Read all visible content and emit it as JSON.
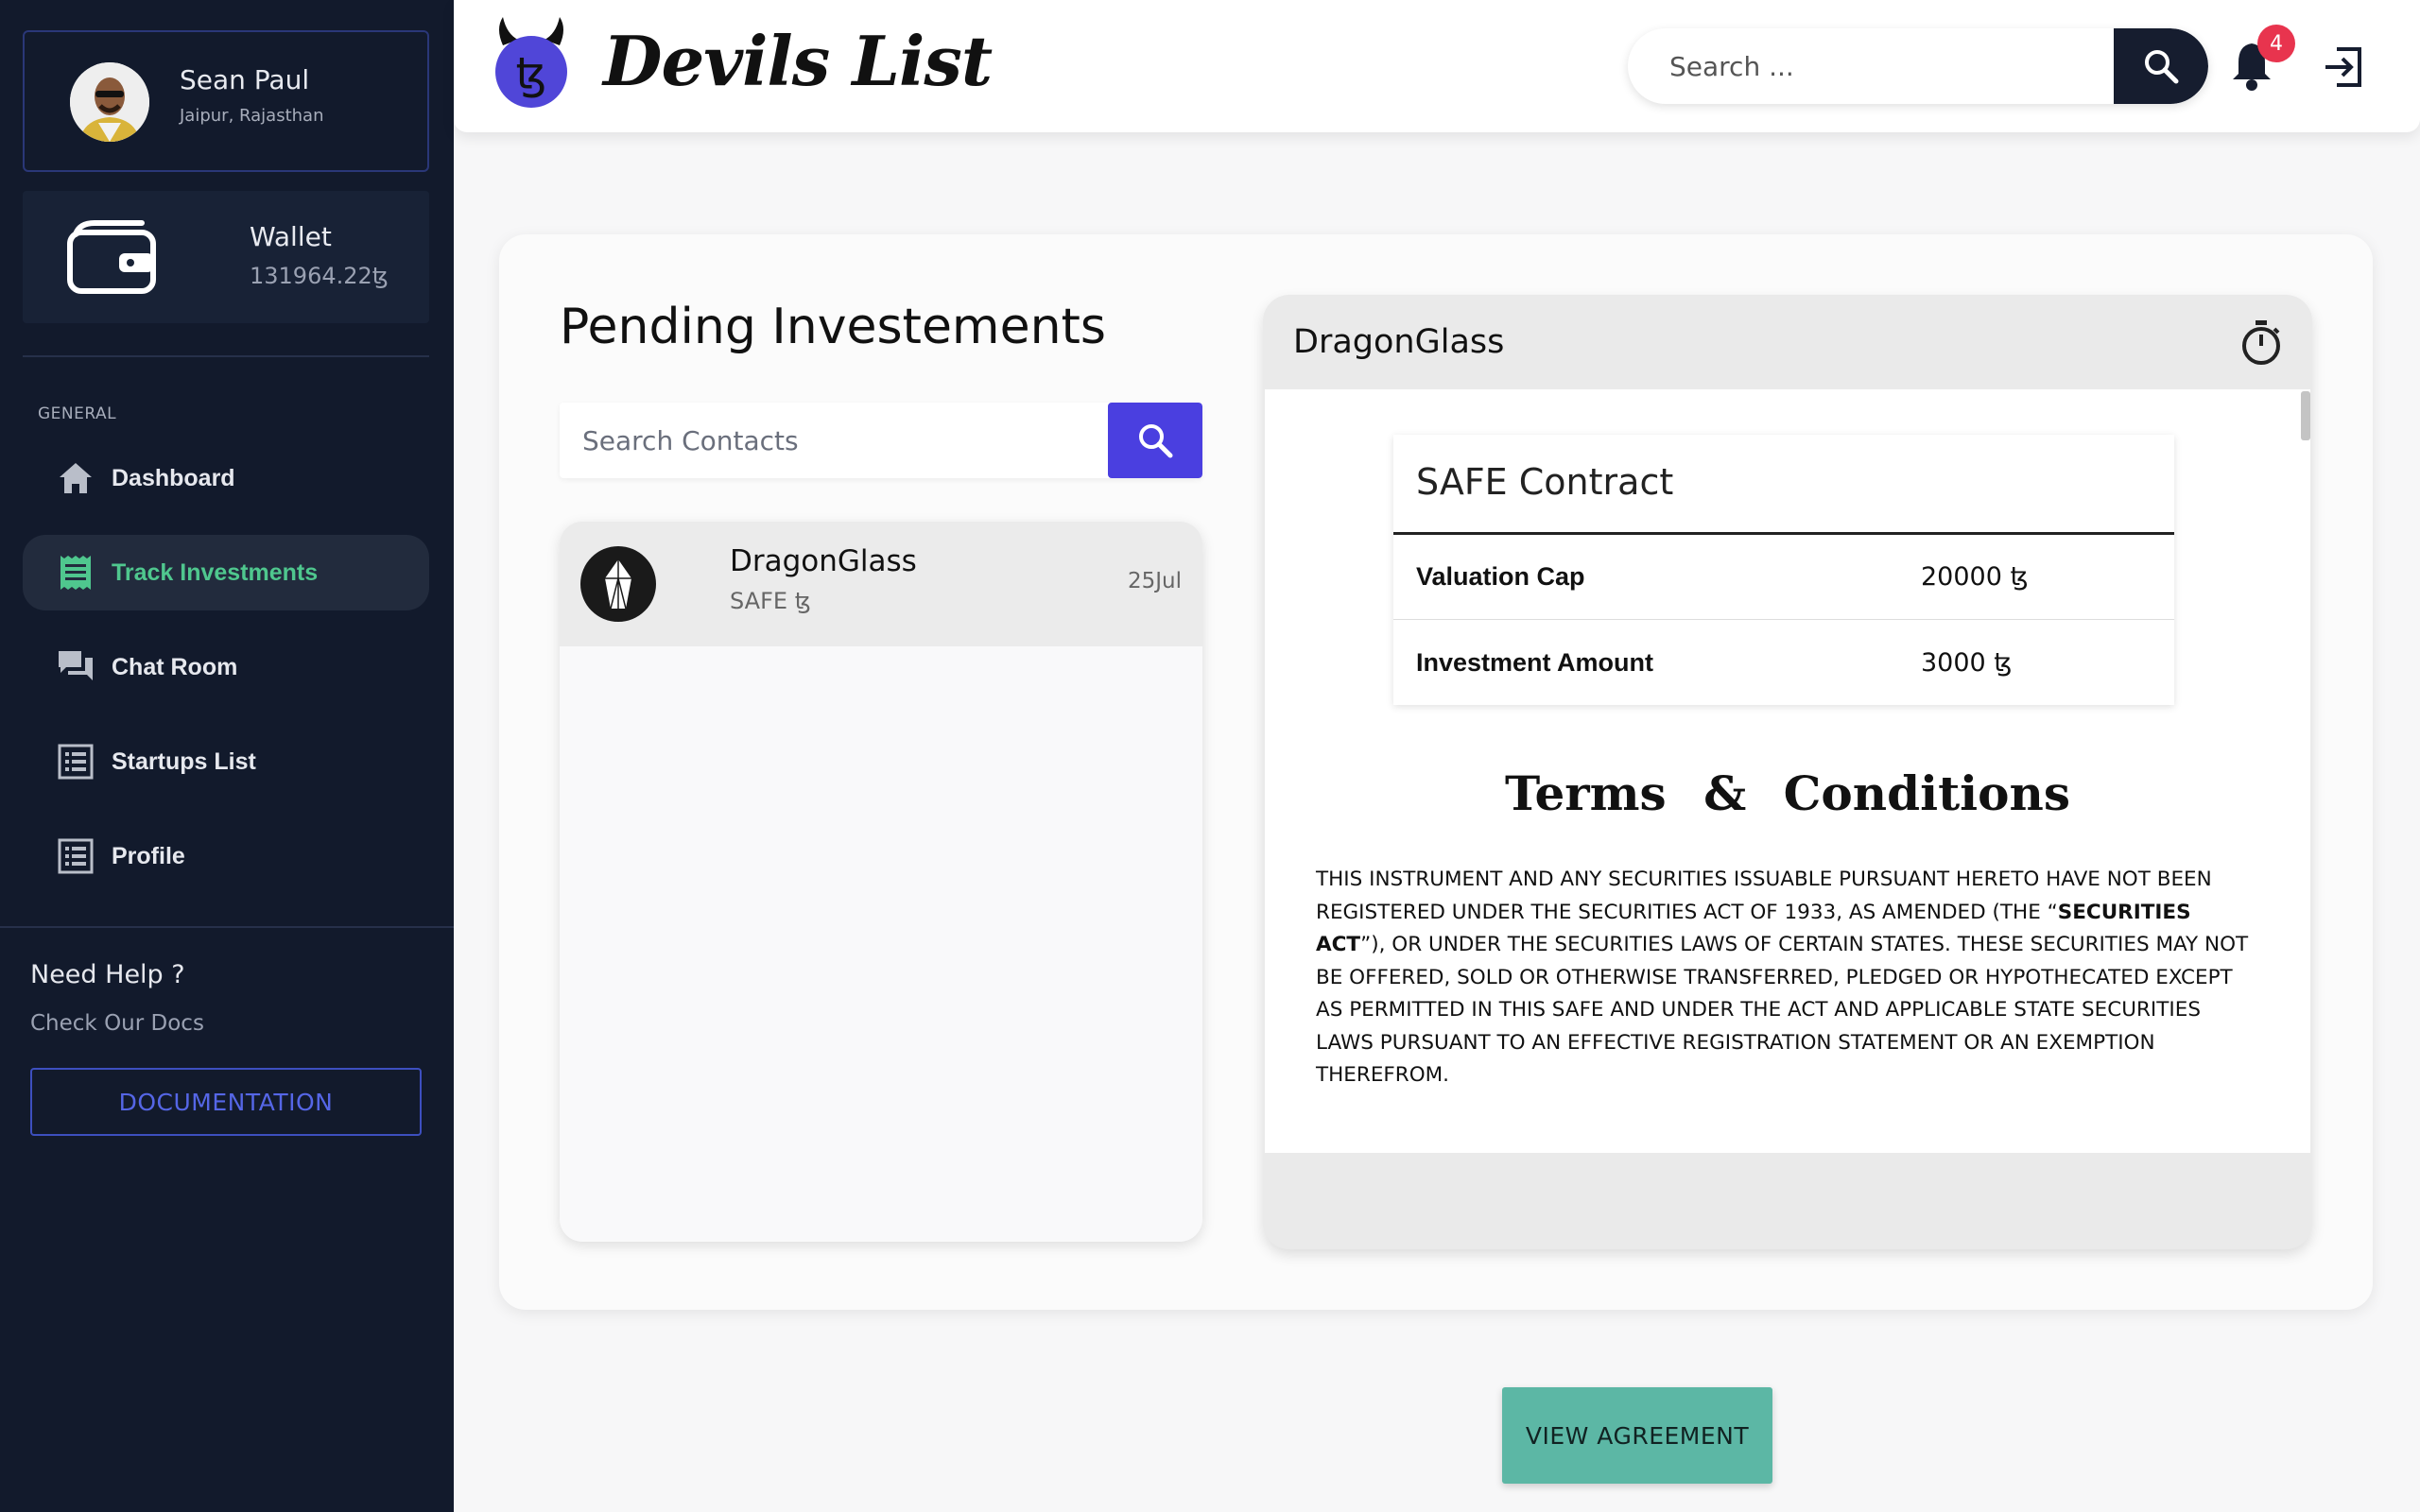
{
  "profile": {
    "name": "Sean Paul",
    "location": "Jaipur, Rajasthan"
  },
  "wallet": {
    "title": "Wallet",
    "amount": "131964.22ꜩ",
    "icon": "wallet-icon"
  },
  "sidebar": {
    "section_label": "GENERAL",
    "items": [
      {
        "label": "Dashboard",
        "icon": "home-icon",
        "active": false
      },
      {
        "label": "Track Investments",
        "icon": "receipt-icon",
        "active": true
      },
      {
        "label": "Chat Room",
        "icon": "chat-icon",
        "active": false
      },
      {
        "label": "Startups List",
        "icon": "list-icon",
        "active": false
      },
      {
        "label": "Profile",
        "icon": "list-icon",
        "active": false
      }
    ],
    "help_title": "Need Help ?",
    "help_sub": "Check Our Docs",
    "doc_button": "DOCUMENTATION"
  },
  "header": {
    "brand": "Devils List",
    "search_placeholder": "Search ...",
    "notification_count": "4"
  },
  "main": {
    "title": "Pending Investements",
    "contact_search_placeholder": "Search Contacts",
    "list": [
      {
        "name": "DragonGlass",
        "type": "SAFE ꜩ",
        "date": "25Jul"
      }
    ]
  },
  "detail": {
    "title": "DragonGlass",
    "contract_title": "SAFE Contract",
    "rows": [
      {
        "label": "Valuation Cap",
        "value": "20000 ꜩ"
      },
      {
        "label": "Investment Amount",
        "value": "3000 ꜩ"
      }
    ],
    "terms_heading": "Terms & Conditions",
    "terms_part1": "THIS INSTRUMENT AND ANY SECURITIES ISSUABLE PURSUANT HERETO HAVE NOT BEEN REGISTERED UNDER THE SECURITIES ACT OF 1933, AS AMENDED (THE “",
    "terms_bold": "SECURITIES ACT",
    "terms_part2": "”), OR UNDER THE SECURITIES LAWS OF CERTAIN STATES.  THESE SECURITIES MAY NOT BE OFFERED, SOLD OR OTHERWISE TRANSFERRED, PLEDGED OR HYPOTHECATED EXCEPT AS PERMITTED IN THIS SAFE AND UNDER THE ACT AND APPLICABLE STATE SECURITIES LAWS PURSUANT TO AN EFFECTIVE REGISTRATION STATEMENT OR AN EXEMPTION THEREFROM.",
    "view_button": "VIEW AGREEMENT"
  },
  "colors": {
    "sidebar_bg": "#121a2c",
    "accent_green": "#4fc78e",
    "accent_indigo": "#4a3fe0",
    "button_teal": "#5cb7a5",
    "badge_red": "#e8344e"
  }
}
